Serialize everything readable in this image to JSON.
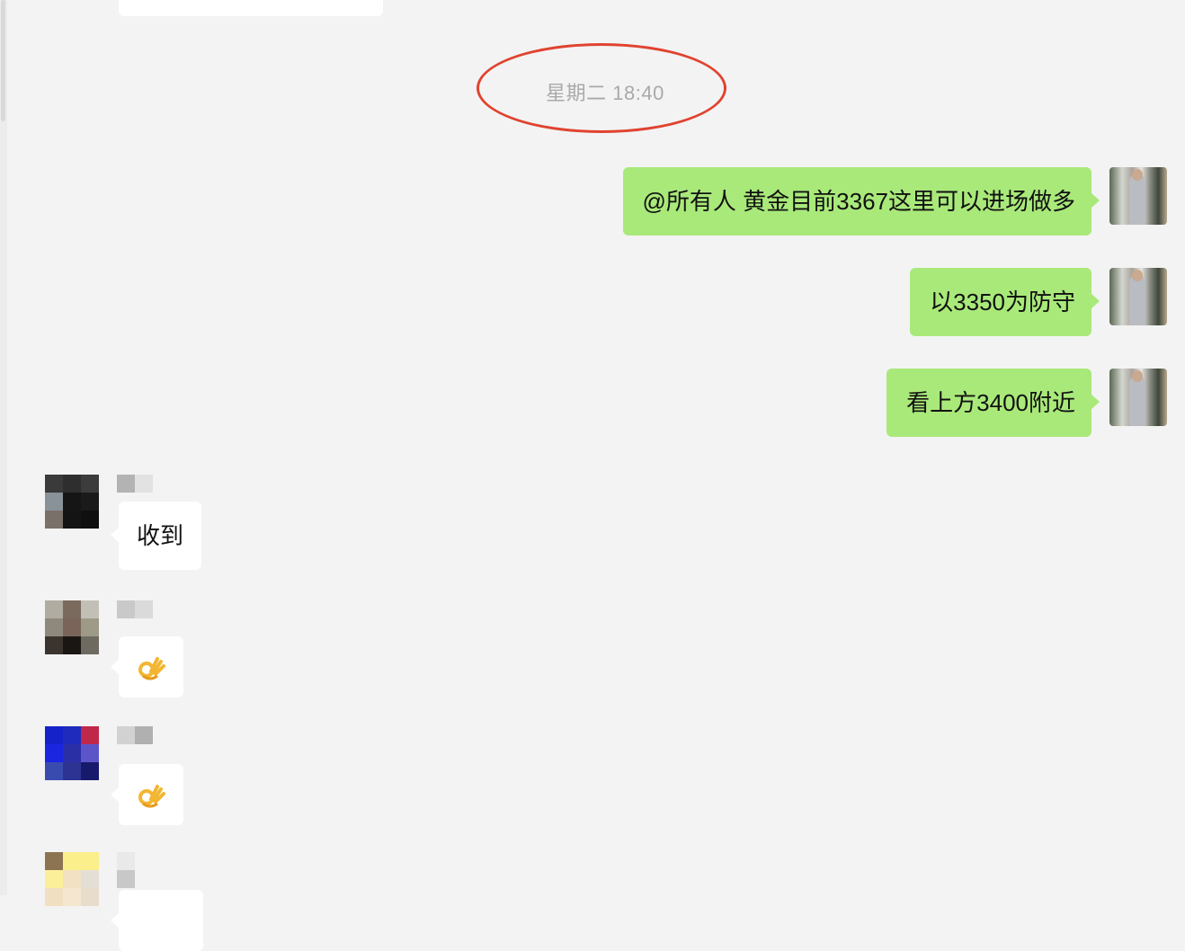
{
  "chat": {
    "timestamp": "星期二 18:40",
    "outgoing": [
      {
        "text": "@所有人 黄金目前3367这里可以进场做多"
      },
      {
        "text": "以3350为防守"
      },
      {
        "text": "看上方3400附近"
      }
    ],
    "incoming": [
      {
        "text": "收到",
        "avatar_colors": [
          "#3a3a3a",
          "#2e2e2e",
          "#3c3c3c",
          "#8a9299",
          "#151515",
          "#1a1a1a",
          "#7a706a",
          "#141414",
          "#0f0f0f"
        ],
        "name_colors": [
          "#b3b3b3",
          "#e2e2e2"
        ]
      },
      {
        "emoji": "ok-hand",
        "avatar_colors": [
          "#b0aca2",
          "#7a6a5e",
          "#c2c0b6",
          "#8f887c",
          "#7a6459",
          "#9d9a88",
          "#3b342e",
          "#1a1614",
          "#6f6a60"
        ],
        "name_colors": [
          "#c9c9c9",
          "#dadada"
        ]
      },
      {
        "emoji": "ok-hand",
        "avatar_colors": [
          "#1521c9",
          "#1f2bbd",
          "#c0284a",
          "#1a26e0",
          "#2a2fa6",
          "#5b55c9",
          "#3a4bb0",
          "#2c3393",
          "#171a6a"
        ],
        "name_colors": [
          "#d2d2d2",
          "#b0b0b0"
        ]
      },
      {
        "emoji": "",
        "avatar_colors": [
          "#8c7452",
          "#fbef8c",
          "#fbef8c",
          "#fbef9a",
          "#f3e1c4",
          "#e4dfd6",
          "#f0dfc0",
          "#f5e6cf",
          "#e8dccc"
        ],
        "name_colors": [
          "#e9e9e9",
          "#c8c8c8"
        ]
      }
    ]
  },
  "colors": {
    "outgoing_bubble": "#a9e97a",
    "incoming_bubble": "#ffffff",
    "background": "#f3f3f3",
    "annotation": "#e0432f"
  }
}
